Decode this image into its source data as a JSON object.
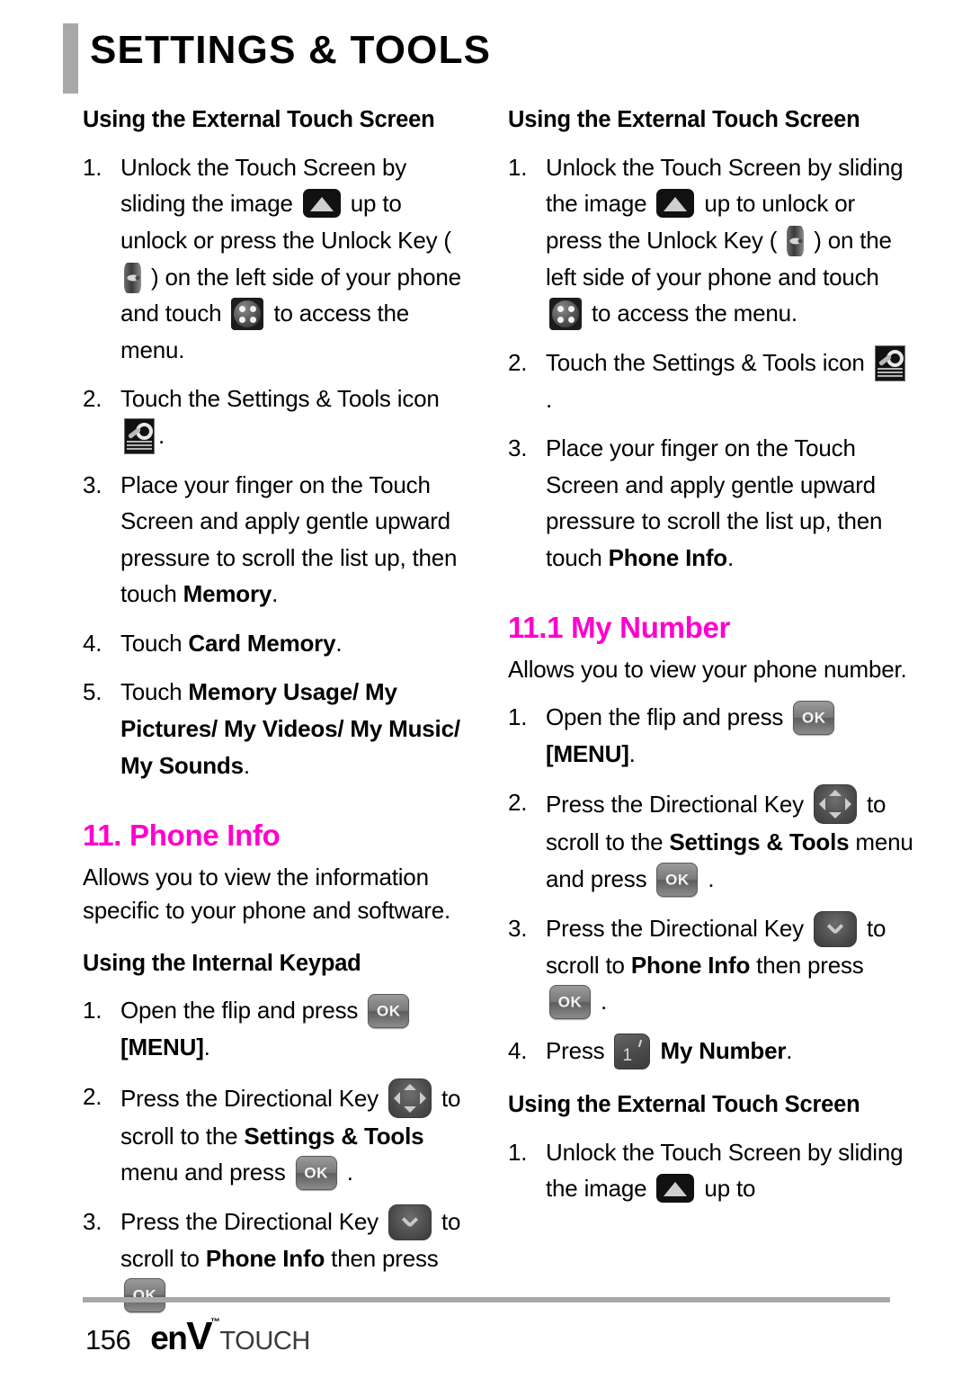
{
  "header": {
    "title": "SETTINGS & TOOLS"
  },
  "left_column": {
    "section1_heading": "Using the External Touch Screen",
    "section1_steps": [
      {
        "num": "1.",
        "parts": [
          {
            "t": "text",
            "v": "Unlock the Touch Screen by sliding the image "
          },
          {
            "t": "icon",
            "v": "unlock-image-icon"
          },
          {
            "t": "text",
            "v": " up to unlock or press the Unlock Key ( "
          },
          {
            "t": "icon",
            "v": "unlock-key-icon"
          },
          {
            "t": "text",
            "v": " ) on the left side of your phone and touch "
          },
          {
            "t": "icon",
            "v": "menu-grid-icon"
          },
          {
            "t": "text",
            "v": " to access the menu."
          }
        ]
      },
      {
        "num": "2.",
        "parts": [
          {
            "t": "text",
            "v": "Touch the Settings & Tools icon "
          },
          {
            "t": "icon",
            "v": "settings-tools-icon"
          },
          {
            "t": "text",
            "v": "."
          }
        ]
      },
      {
        "num": "3.",
        "parts": [
          {
            "t": "text",
            "v": "Place your finger on the Touch Screen and apply gentle upward pressure to scroll the list up, then touch "
          },
          {
            "t": "bold",
            "v": "Memory"
          },
          {
            "t": "text",
            "v": "."
          }
        ]
      },
      {
        "num": "4.",
        "parts": [
          {
            "t": "text",
            "v": "Touch "
          },
          {
            "t": "bold",
            "v": "Card Memory"
          },
          {
            "t": "text",
            "v": "."
          }
        ]
      },
      {
        "num": "5.",
        "parts": [
          {
            "t": "text",
            "v": "Touch "
          },
          {
            "t": "bold",
            "v": "Memory Usage/ My Pictures/ My Videos/ My Music/ My Sounds"
          },
          {
            "t": "text",
            "v": "."
          }
        ]
      }
    ],
    "phone_info_heading": "11. Phone Info",
    "phone_info_body": "Allows you to view the information specific to your phone and software.",
    "section2_heading": "Using the Internal Keypad",
    "section2_steps": [
      {
        "num": "1.",
        "parts": [
          {
            "t": "text",
            "v": "Open the flip and press "
          },
          {
            "t": "icon",
            "v": "ok-key-icon"
          },
          {
            "t": "text",
            "v": " "
          },
          {
            "t": "bold",
            "v": "[MENU]"
          },
          {
            "t": "text",
            "v": "."
          }
        ]
      },
      {
        "num": "2.",
        "parts": [
          {
            "t": "text",
            "v": "Press the Directional Key "
          },
          {
            "t": "icon",
            "v": "directional-key-icon"
          },
          {
            "t": "text",
            "v": " to scroll to the "
          },
          {
            "t": "bold",
            "v": "Settings & Tools"
          },
          {
            "t": "text",
            "v": " menu and press "
          },
          {
            "t": "icon",
            "v": "ok-key-icon"
          },
          {
            "t": "text",
            "v": " ."
          }
        ]
      },
      {
        "num": "3.",
        "parts": [
          {
            "t": "text",
            "v": "Press the Directional Key "
          },
          {
            "t": "icon",
            "v": "directional-down-key-icon"
          },
          {
            "t": "text",
            "v": " to scroll to "
          },
          {
            "t": "bold",
            "v": "Phone Info"
          },
          {
            "t": "text",
            "v": " then press "
          },
          {
            "t": "icon",
            "v": "ok-key-icon"
          },
          {
            "t": "text",
            "v": " ."
          }
        ]
      }
    ]
  },
  "right_column": {
    "section1_heading": "Using the External Touch Screen",
    "section1_steps": [
      {
        "num": "1.",
        "parts": [
          {
            "t": "text",
            "v": "Unlock the Touch Screen by sliding the image "
          },
          {
            "t": "icon",
            "v": "unlock-image-icon"
          },
          {
            "t": "text",
            "v": " up to unlock or press the Unlock Key ( "
          },
          {
            "t": "icon",
            "v": "unlock-key-icon"
          },
          {
            "t": "text",
            "v": " ) on the left side of your phone and touch "
          },
          {
            "t": "icon",
            "v": "menu-grid-icon"
          },
          {
            "t": "text",
            "v": " to access the menu."
          }
        ]
      },
      {
        "num": "2.",
        "parts": [
          {
            "t": "text",
            "v": "Touch the Settings & Tools icon "
          },
          {
            "t": "icon",
            "v": "settings-tools-icon"
          },
          {
            "t": "text",
            "v": "."
          }
        ]
      },
      {
        "num": "3.",
        "parts": [
          {
            "t": "text",
            "v": "Place your finger on the Touch Screen and apply gentle upward pressure to scroll the list up, then touch "
          },
          {
            "t": "bold",
            "v": "Phone Info"
          },
          {
            "t": "text",
            "v": "."
          }
        ]
      }
    ],
    "my_number_heading": "11.1 My Number",
    "my_number_body": "Allows you to view your phone number.",
    "my_number_steps": [
      {
        "num": "1.",
        "parts": [
          {
            "t": "text",
            "v": "Open the flip and press "
          },
          {
            "t": "icon",
            "v": "ok-key-icon"
          },
          {
            "t": "text",
            "v": " "
          },
          {
            "t": "bold",
            "v": "[MENU]"
          },
          {
            "t": "text",
            "v": "."
          }
        ]
      },
      {
        "num": "2.",
        "parts": [
          {
            "t": "text",
            "v": "Press the Directional Key "
          },
          {
            "t": "icon",
            "v": "directional-key-icon"
          },
          {
            "t": "text",
            "v": " to scroll to the "
          },
          {
            "t": "bold",
            "v": "Settings & Tools"
          },
          {
            "t": "text",
            "v": " menu and press "
          },
          {
            "t": "icon",
            "v": "ok-key-icon"
          },
          {
            "t": "text",
            "v": " ."
          }
        ]
      },
      {
        "num": "3.",
        "parts": [
          {
            "t": "text",
            "v": "Press the Directional Key "
          },
          {
            "t": "icon",
            "v": "directional-down-key-icon"
          },
          {
            "t": "text",
            "v": " to scroll to "
          },
          {
            "t": "bold",
            "v": "Phone Info"
          },
          {
            "t": "text",
            "v": " then press "
          },
          {
            "t": "icon",
            "v": "ok-key-icon"
          },
          {
            "t": "text",
            "v": " ."
          }
        ]
      },
      {
        "num": "4.",
        "parts": [
          {
            "t": "text",
            "v": "Press "
          },
          {
            "t": "icon",
            "v": "key-1-icon"
          },
          {
            "t": "text",
            "v": " "
          },
          {
            "t": "bold",
            "v": "My Number"
          },
          {
            "t": "text",
            "v": "."
          }
        ]
      }
    ],
    "section2_heading": "Using the External Touch Screen",
    "section2_steps": [
      {
        "num": "1.",
        "parts": [
          {
            "t": "text",
            "v": "Unlock the Touch Screen by sliding the image "
          },
          {
            "t": "icon",
            "v": "unlock-image-icon"
          },
          {
            "t": "text",
            "v": " up to"
          }
        ]
      }
    ]
  },
  "footer": {
    "page_number": "156",
    "brand_en": "en",
    "brand_v": "V",
    "brand_tm": "™",
    "brand_touch": "TOUCH"
  },
  "colors": {
    "accent_pink": "#FF00CC",
    "rule_gray": "#A8A8A8",
    "text_black": "#000000"
  }
}
